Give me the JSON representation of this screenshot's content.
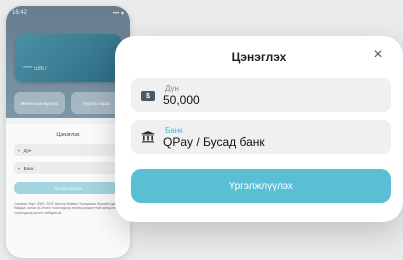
{
  "phone": {
    "status_time": "16:42",
    "status_signal": "••• ▾",
    "card_number": "**** 5867",
    "mini_buttons": [
      "Мөнгө шилжүүлэх",
      "Хуулга харах"
    ],
    "sheet_title": "Цэнэглэх",
    "rows": [
      "Дүн",
      "Банк"
    ],
    "cta": "Үргэлжлүүлэх",
    "note": "Санамж: Карт 3000. 2022 Фактор Вэйжиг Хугацааны Жилийн давуу байдал, ялгаа нь Ихэнх тохиолдолд төлбөр амжилттай хийгдсэн тохиолдолд эргэлт хийгдэхгүй."
  },
  "modal": {
    "title": "Цэнэглэх",
    "close_symbol": "×",
    "amount": {
      "label": "Дүн",
      "value": "50,000"
    },
    "bank": {
      "label": "Банк",
      "value": "QPay / Бусад банк"
    },
    "continue_label": "Үргэлжлүүлэх",
    "accent_color": "#59bfd5"
  }
}
